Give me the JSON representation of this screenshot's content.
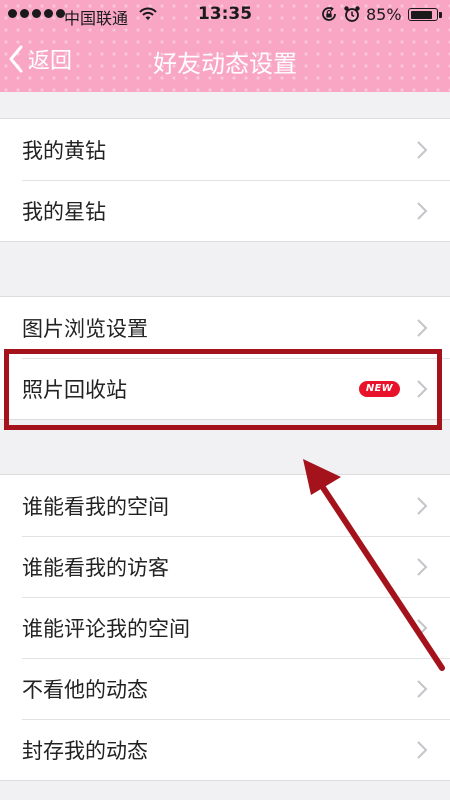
{
  "status_bar": {
    "carrier": "中国联通",
    "time": "13:35",
    "battery_percent": "85%",
    "battery_level": 0.85
  },
  "nav": {
    "back_label": "返回",
    "title": "好友动态设置"
  },
  "groups": [
    {
      "items": [
        {
          "label": "我的黄钻"
        },
        {
          "label": "我的星钻"
        }
      ]
    },
    {
      "items": [
        {
          "label": "图片浏览设置"
        },
        {
          "label": "照片回收站",
          "badge": "NEW"
        }
      ]
    },
    {
      "items": [
        {
          "label": "谁能看我的空间"
        },
        {
          "label": "谁能看我的访客"
        },
        {
          "label": "谁能评论我的空间"
        },
        {
          "label": "不看他的动态"
        },
        {
          "label": "封存我的动态"
        }
      ]
    }
  ],
  "colors": {
    "header": "#f8a6c4",
    "badge": "#e8132a",
    "annotation": "#a4121c"
  },
  "icons": [
    "signal-dots-icon",
    "wifi-icon",
    "rotation-lock-icon",
    "alarm-icon",
    "battery-icon",
    "back-chevron-icon",
    "chevron-right-icon"
  ]
}
